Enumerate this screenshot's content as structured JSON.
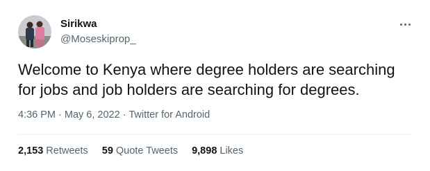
{
  "user": {
    "display_name": "Sirikwa",
    "handle": "@Moseskiprop_",
    "avatar_icon": "profile-photo"
  },
  "tweet": {
    "text": "Welcome to Kenya where degree holders are searching\nfor jobs and job holders are searching for degrees."
  },
  "meta": {
    "time": "4:36 PM",
    "separator": " · ",
    "date": "May 6, 2022",
    "source": "Twitter for Android"
  },
  "stats": {
    "retweets_count": "2,153",
    "retweets_label": "Retweets",
    "quotes_count": "59",
    "quotes_label": "Quote Tweets",
    "likes_count": "9,898",
    "likes_label": "Likes"
  },
  "colors": {
    "primary_text": "#0f1419",
    "secondary_text": "#536471",
    "divider": "#eff3f4"
  }
}
